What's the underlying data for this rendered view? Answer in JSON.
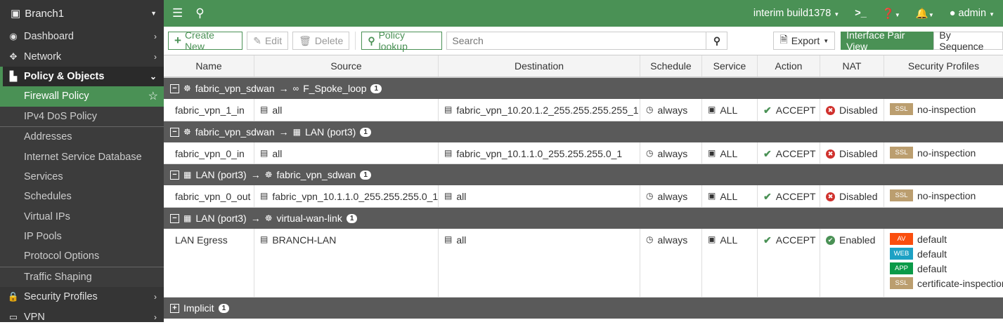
{
  "sidebar": {
    "device": "Branch1",
    "items": [
      {
        "label": "Dashboard",
        "icon": "dashboard-icon",
        "glyph": "◉",
        "type": "top"
      },
      {
        "label": "Network",
        "icon": "network-icon",
        "glyph": "✥",
        "type": "top"
      },
      {
        "label": "Policy & Objects",
        "icon": "policy-icon",
        "glyph": "▙",
        "type": "open"
      },
      {
        "label": "Firewall Policy",
        "type": "active"
      },
      {
        "label": "IPv4 DoS Policy",
        "type": "sub"
      },
      {
        "type": "sep"
      },
      {
        "label": "Addresses",
        "type": "sub"
      },
      {
        "label": "Internet Service Database",
        "type": "sub"
      },
      {
        "label": "Services",
        "type": "sub"
      },
      {
        "label": "Schedules",
        "type": "sub"
      },
      {
        "label": "Virtual IPs",
        "type": "sub"
      },
      {
        "label": "IP Pools",
        "type": "sub"
      },
      {
        "label": "Protocol Options",
        "type": "sub"
      },
      {
        "type": "sep"
      },
      {
        "label": "Traffic Shaping",
        "type": "sub"
      },
      {
        "label": "Security Profiles",
        "icon": "lock-icon",
        "glyph": "🔒",
        "type": "top"
      },
      {
        "label": "VPN",
        "icon": "vpn-icon",
        "glyph": "▭",
        "type": "top"
      }
    ]
  },
  "topbar": {
    "build": "interim build1378",
    "user": "admin"
  },
  "toolbar": {
    "create": "Create New",
    "edit": "Edit",
    "delete": "Delete",
    "lookup": "Policy lookup",
    "search_placeholder": "Search",
    "export": "Export",
    "view_pair": "Interface Pair View",
    "view_seq": "By Sequence"
  },
  "columns": [
    "Name",
    "Source",
    "Destination",
    "Schedule",
    "Service",
    "Action",
    "NAT",
    "Security Profiles"
  ],
  "groups": [
    {
      "from": "fabric_vpn_sdwan",
      "to": "F_Spoke_loop",
      "count": "1",
      "from_icon": "☸",
      "to_icon": "∞",
      "rows": [
        {
          "name": "fabric_vpn_1_in",
          "source": "all",
          "destination": "fabric_vpn_10.20.1.2_255.255.255.255_1",
          "schedule": "always",
          "service": "ALL",
          "action": "ACCEPT",
          "nat": "Disabled",
          "nat_on": false,
          "profiles": [
            {
              "tag": "SSL",
              "color": "#bb9e6f",
              "value": "no-inspection"
            }
          ]
        }
      ]
    },
    {
      "from": "fabric_vpn_sdwan",
      "to": "LAN (port3)",
      "count": "1",
      "from_icon": "☸",
      "to_icon": "▦",
      "rows": [
        {
          "name": "fabric_vpn_0_in",
          "source": "all",
          "destination": "fabric_vpn_10.1.1.0_255.255.255.0_1",
          "schedule": "always",
          "service": "ALL",
          "action": "ACCEPT",
          "nat": "Disabled",
          "nat_on": false,
          "profiles": [
            {
              "tag": "SSL",
              "color": "#bb9e6f",
              "value": "no-inspection"
            }
          ]
        }
      ]
    },
    {
      "from": "LAN (port3)",
      "to": "fabric_vpn_sdwan",
      "count": "1",
      "from_icon": "▦",
      "to_icon": "☸",
      "rows": [
        {
          "name": "fabric_vpn_0_out",
          "source": "fabric_vpn_10.1.1.0_255.255.255.0_1",
          "destination": "all",
          "schedule": "always",
          "service": "ALL",
          "action": "ACCEPT",
          "nat": "Disabled",
          "nat_on": false,
          "profiles": [
            {
              "tag": "SSL",
              "color": "#bb9e6f",
              "value": "no-inspection"
            }
          ]
        }
      ]
    },
    {
      "from": "LAN (port3)",
      "to": "virtual-wan-link",
      "count": "1",
      "from_icon": "▦",
      "to_icon": "☸",
      "rows": [
        {
          "name": "LAN Egress",
          "source": "BRANCH-LAN",
          "destination": "all",
          "schedule": "always",
          "service": "ALL",
          "action": "ACCEPT",
          "nat": "Enabled",
          "nat_on": true,
          "profiles": [
            {
              "tag": "AV",
              "color": "#fa4e0e",
              "value": "default"
            },
            {
              "tag": "WEB",
              "color": "#1da1c4",
              "value": "default"
            },
            {
              "tag": "APP",
              "color": "#0a9a48",
              "value": "default"
            },
            {
              "tag": "SSL",
              "color": "#bb9e6f",
              "value": "certificate-inspection"
            }
          ]
        }
      ]
    }
  ],
  "implicit": {
    "label": "Implicit",
    "count": "1"
  }
}
